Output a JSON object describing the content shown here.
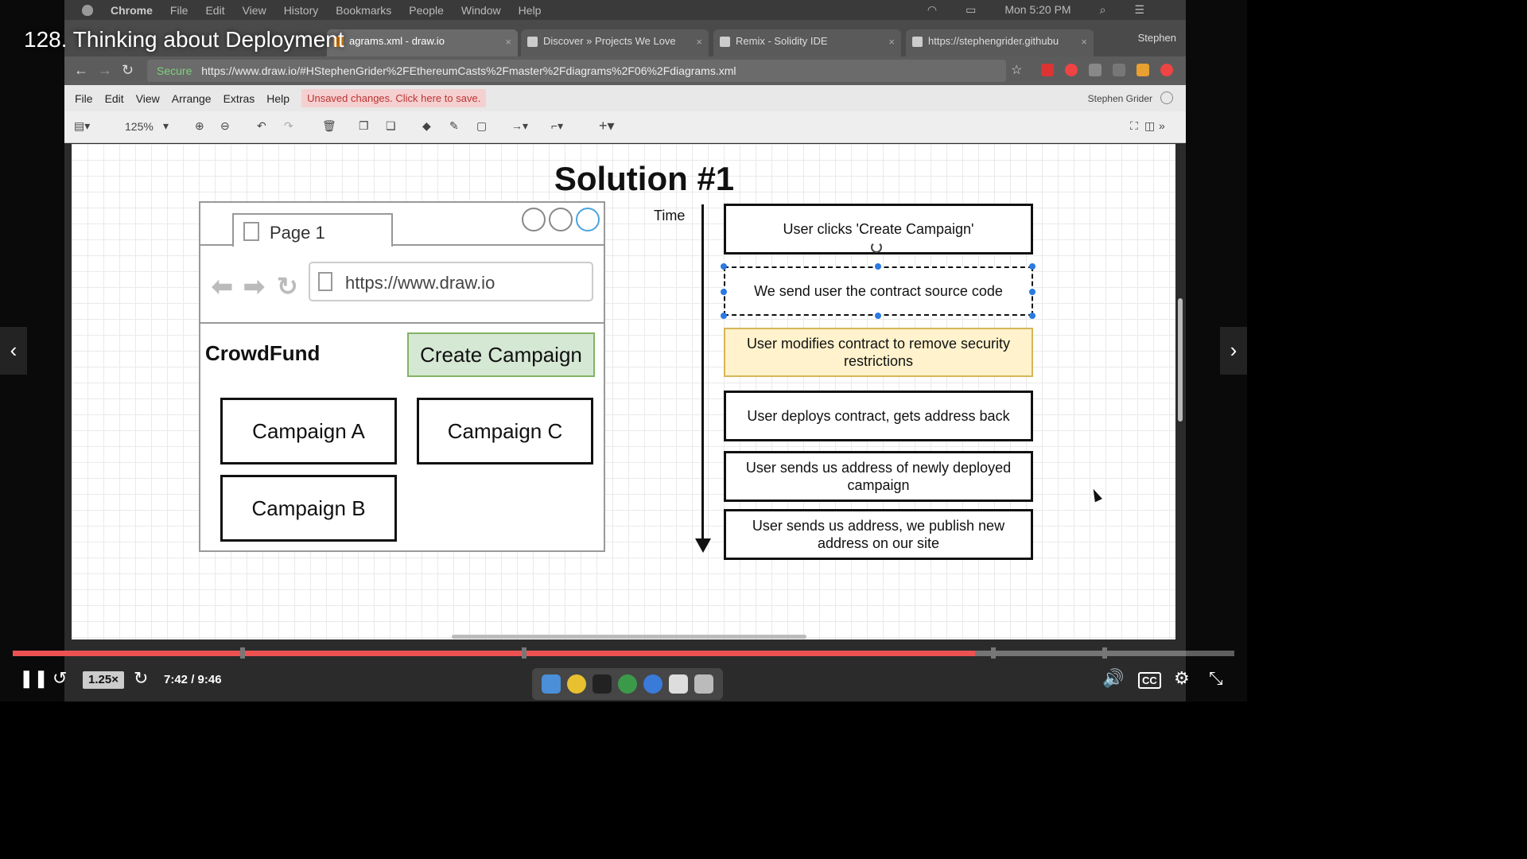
{
  "video": {
    "title": "128. Thinking about Deployment",
    "speed": "1.25",
    "speed_suffix": "×",
    "current_time": "7:42",
    "duration": "9:46",
    "progress": 0.788,
    "cc_label": "CC"
  },
  "os_menubar": {
    "app": "Chrome",
    "items": [
      "File",
      "Edit",
      "View",
      "History",
      "Bookmarks",
      "People",
      "Window",
      "Help"
    ],
    "clock": "Mon 5:20 PM"
  },
  "browser": {
    "tabs": [
      {
        "label": "agrams.xml - draw.io"
      },
      {
        "label": "Discover » Projects We Love"
      },
      {
        "label": "Remix - Solidity IDE"
      },
      {
        "label": "https://stephengrider.githubu"
      }
    ],
    "profile": "Stephen",
    "secure_label": "Secure",
    "url": "https://www.draw.io/#HStephenGrider%2FEthereumCasts%2Fmaster%2Fdiagrams%2F06%2Fdiagrams.xml"
  },
  "drawio": {
    "menu": [
      "File",
      "Edit",
      "View",
      "Arrange",
      "Extras",
      "Help"
    ],
    "unsaved": "Unsaved changes. Click here to save.",
    "user": "Stephen Grider",
    "zoom": "125%"
  },
  "diagram": {
    "title": "Solution #1",
    "mock_tab": "Page 1",
    "mock_url": "https://www.draw.io",
    "brand": "CrowdFund",
    "create_button": "Create Campaign",
    "campaigns": [
      "Campaign A",
      "Campaign C",
      "Campaign B"
    ],
    "time_label": "Time",
    "steps": [
      "User clicks 'Create Campaign'",
      "We send user the contract source code",
      "User modifies contract to remove security restrictions",
      "User deploys contract, gets address back",
      "User sends us address of newly deployed campaign",
      "User sends us address, we publish new address on our site"
    ]
  }
}
